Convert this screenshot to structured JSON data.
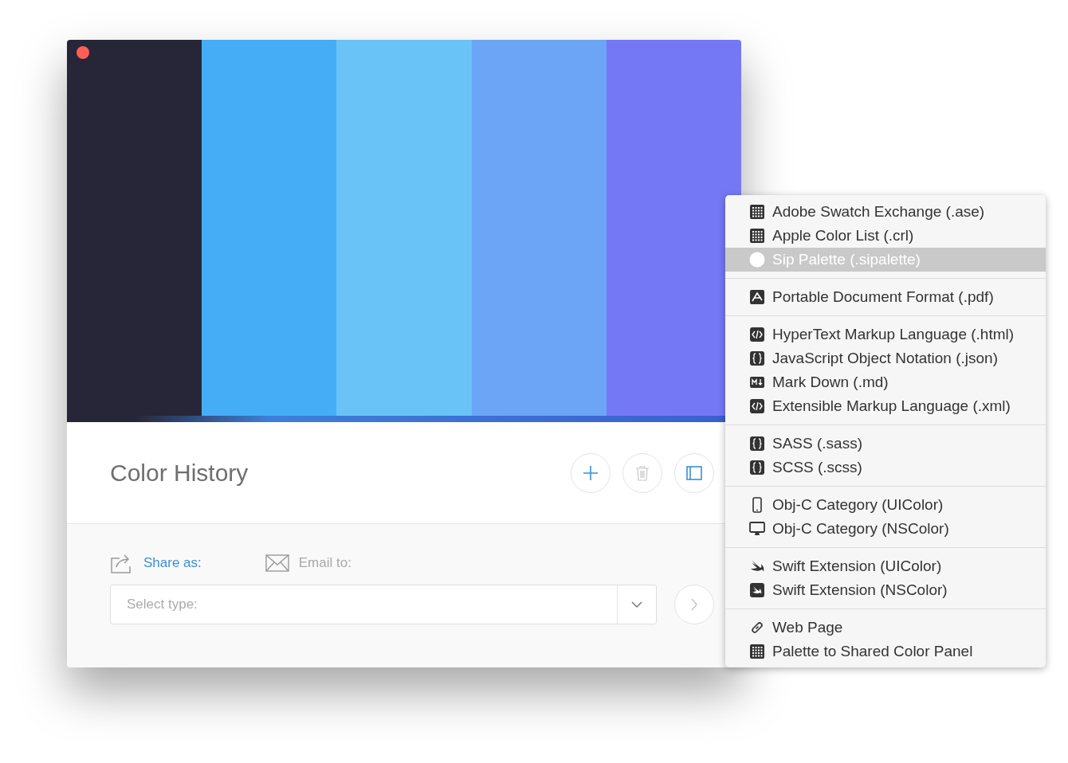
{
  "swatches": [
    {
      "color": "#272638"
    },
    {
      "color": "#45adf5"
    },
    {
      "color": "#6ac3f6"
    },
    {
      "color": "#6ca5f6"
    },
    {
      "color": "#7578f5"
    }
  ],
  "header": {
    "title": "Color History"
  },
  "share": {
    "options": [
      {
        "label": "Share as:",
        "kind": "share",
        "selected": true
      },
      {
        "label": "Email to:",
        "kind": "email",
        "selected": false
      }
    ],
    "select": {
      "placeholder": "Select type:"
    }
  },
  "menu": {
    "groups": [
      {
        "items": [
          {
            "label": "Adobe Swatch Exchange (.ase)",
            "kind": "grid",
            "selected": false
          },
          {
            "label": "Apple Color List (.crl)",
            "kind": "grid",
            "selected": false
          },
          {
            "label": "Sip Palette (.sipalette)",
            "kind": "circle",
            "selected": true
          }
        ]
      },
      {
        "items": [
          {
            "label": "Portable Document Format (.pdf)",
            "kind": "pdf",
            "selected": false
          }
        ]
      },
      {
        "items": [
          {
            "label": "HyperText Markup Language (.html)",
            "kind": "code",
            "selected": false
          },
          {
            "label": "JavaScript Object Notation (.json)",
            "kind": "braces",
            "selected": false
          },
          {
            "label": "Mark Down (.md)",
            "kind": "markdown",
            "selected": false
          },
          {
            "label": "Extensible Markup Language (.xml)",
            "kind": "code",
            "selected": false
          }
        ]
      },
      {
        "items": [
          {
            "label": "SASS (.sass)",
            "kind": "braces",
            "selected": false
          },
          {
            "label": "SCSS (.scss)",
            "kind": "braces",
            "selected": false
          }
        ]
      },
      {
        "items": [
          {
            "label": "Obj-C Category (UIColor)",
            "kind": "phone",
            "selected": false
          },
          {
            "label": "Obj-C Category (NSColor)",
            "kind": "monitor",
            "selected": false
          }
        ]
      },
      {
        "items": [
          {
            "label": "Swift Extension (UIColor)",
            "kind": "swift",
            "selected": false
          },
          {
            "label": "Swift Extension (NSColor)",
            "kind": "swift-box",
            "selected": false
          }
        ]
      },
      {
        "items": [
          {
            "label": "Web Page",
            "kind": "link",
            "selected": false
          },
          {
            "label": "Palette to Shared Color Panel",
            "kind": "grid",
            "selected": false
          }
        ]
      }
    ]
  }
}
